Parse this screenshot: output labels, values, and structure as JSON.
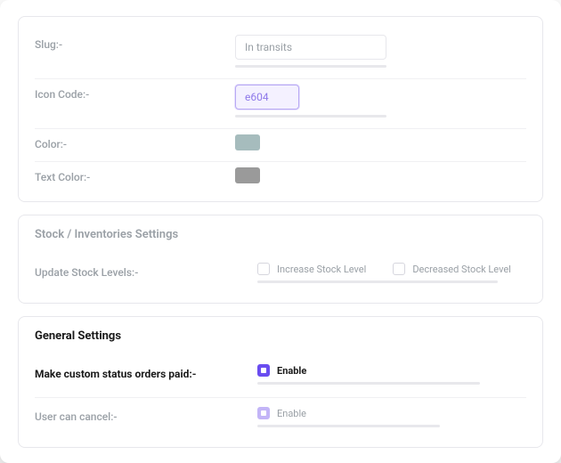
{
  "status_card": {
    "slug_label": "Slug:-",
    "slug_value": "In transits",
    "icon_code_label": "Icon Code:-",
    "icon_code_value": "e604",
    "color_label": "Color:-",
    "color_value": "#a6bcbd",
    "text_color_label": "Text Color:-",
    "text_color_value": "#9a9a9a"
  },
  "stock_card": {
    "title": "Stock / Inventories Settings",
    "update_label": "Update Stock Levels:-",
    "increase_label": "Increase Stock Level",
    "decrease_label": "Decreased Stock Level"
  },
  "general_card": {
    "title": "General Settings",
    "paid_label": "Make custom status orders paid:-",
    "paid_enable": "Enable",
    "cancel_label": "User can cancel:-",
    "cancel_enable": "Enable"
  }
}
